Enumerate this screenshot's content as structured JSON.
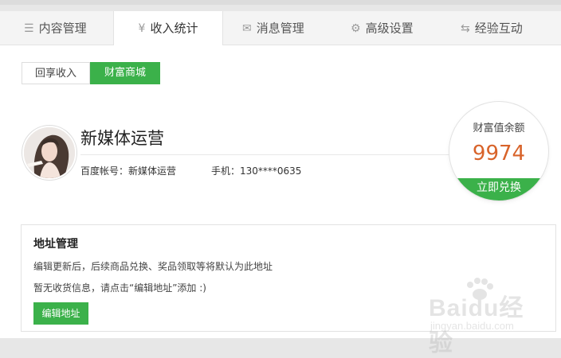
{
  "tabs": [
    {
      "label": "内容管理",
      "icon": "list-icon"
    },
    {
      "label": "收入统计",
      "icon": "yen-icon",
      "active": true
    },
    {
      "label": "消息管理",
      "icon": "envelope-icon"
    },
    {
      "label": "高级设置",
      "icon": "gear-icon"
    },
    {
      "label": "经验互动",
      "icon": "swap-arrows-icon"
    }
  ],
  "subtabs": {
    "share_income": "回享收入",
    "wealth_mall": "财富商城",
    "selected": "财富商城"
  },
  "profile": {
    "name": "新媒体运营",
    "account_label": "百度帐号：新媒体运营",
    "phone_label": "手机：130****0635"
  },
  "wealth": {
    "label": "财富值余额",
    "value": "9974",
    "button": "立即兑换",
    "value_color": "#d8632a"
  },
  "address": {
    "title": "地址管理",
    "note1": "编辑更新后，后续商品兑换、奖品领取等将默认为此地址",
    "note2": "暂无收货信息，请点击“编辑地址”添加 :)",
    "button": "编辑地址"
  },
  "watermark": {
    "brand": "Baidu经验",
    "site": "jingyan.baidu.com"
  },
  "colors": {
    "accent": "#3bb14a",
    "tab_bg": "#f4f4f4",
    "value": "#d8632a"
  }
}
